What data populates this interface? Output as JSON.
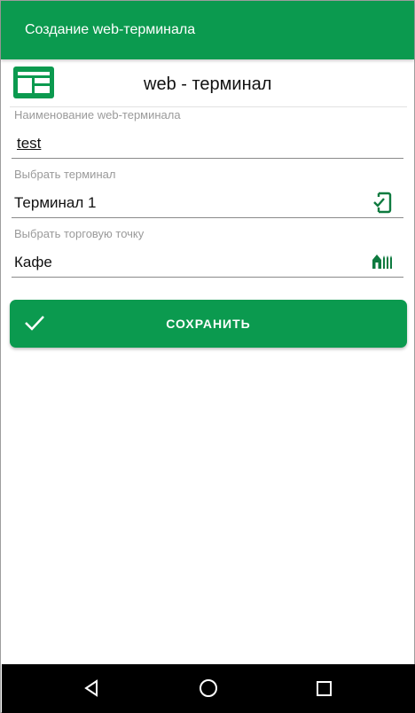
{
  "appbar": {
    "title": "Создание web-терминала"
  },
  "header": {
    "icon": "web-terminal-icon",
    "title": "web - терминал"
  },
  "fields": [
    {
      "label": "Наименование web-терминала",
      "value": "test"
    },
    {
      "label": "Выбрать терминал",
      "value": "Терминал 1",
      "icon": "phone-check-icon"
    },
    {
      "label": "Выбрать торговую точку",
      "value": "Кафе",
      "icon": "store-icon"
    }
  ],
  "save_button": {
    "label": "СОХРАНИТЬ",
    "icon": "check-icon"
  },
  "navbar": {
    "back_icon": "back-icon",
    "home_icon": "home-icon",
    "recents_icon": "recents-icon"
  },
  "colors": {
    "accent": "#0b9a4f",
    "navbar": "#000000",
    "label": "#9a9a9a"
  }
}
